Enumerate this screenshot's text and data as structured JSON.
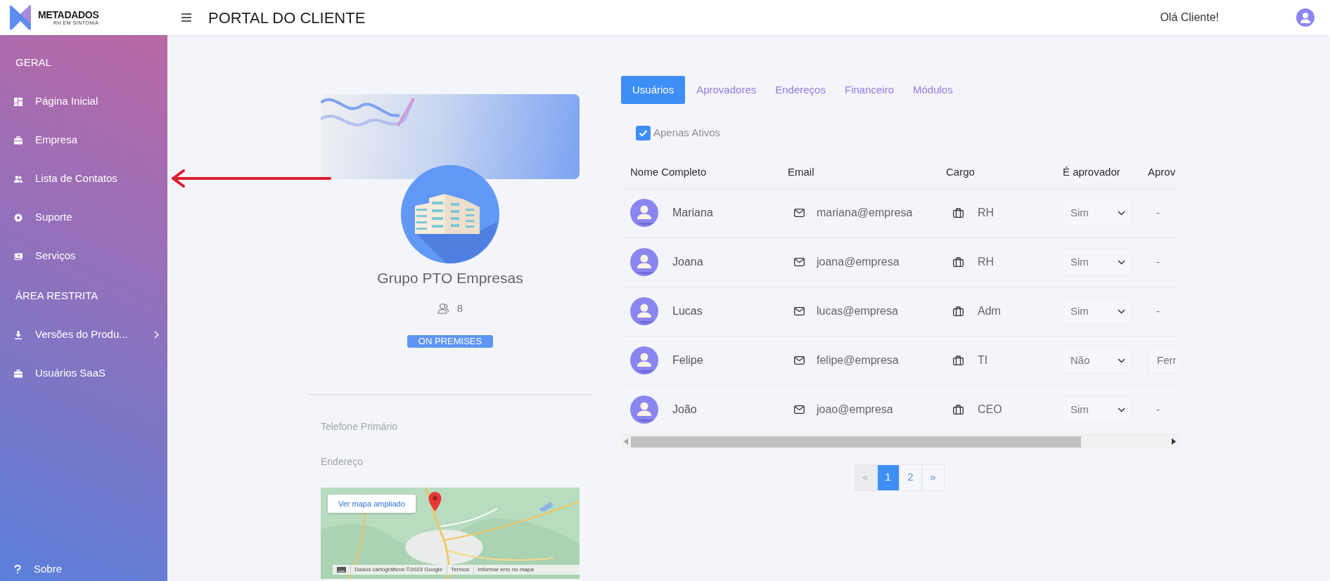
{
  "header": {
    "brand": "METADADOS",
    "tagline": "RH EM SINTONIA",
    "title": "PORTAL DO CLIENTE",
    "greeting": "Olá Cliente!"
  },
  "sidebar": {
    "sections": [
      {
        "heading": "GERAL",
        "items": [
          {
            "label": "Página Inicial",
            "has_submenu": false
          },
          {
            "label": "Empresa",
            "has_submenu": false
          },
          {
            "label": "Lista de Contatos",
            "has_submenu": false
          },
          {
            "label": "Suporte",
            "has_submenu": false
          },
          {
            "label": "Serviços",
            "has_submenu": false
          }
        ]
      },
      {
        "heading": "ÁREA RESTRITA",
        "items": [
          {
            "label": "Versões do Produ...",
            "has_submenu": true
          },
          {
            "label": "Usuários SaaS",
            "has_submenu": false
          }
        ]
      }
    ],
    "footer": "Sobre"
  },
  "company": {
    "name": "Grupo PTO Empresas",
    "users": "8",
    "badge": "ON PREMISES",
    "fields": [
      "Telefone Primário",
      "Endereço"
    ],
    "map": {
      "link": "Ver mapa ampliado",
      "attribution": [
        "Dados cartográficos ©2023 Google",
        "Termos",
        "Informar erro no mapa"
      ]
    }
  },
  "tabs": [
    {
      "label": "Usuários",
      "selected": true
    },
    {
      "label": "Aprovadores",
      "selected": false
    },
    {
      "label": "Endereços",
      "selected": false
    },
    {
      "label": "Financeiro",
      "selected": false
    },
    {
      "label": "Módulos",
      "selected": false
    }
  ],
  "filter": {
    "label": "Apenas Ativos",
    "checked": true
  },
  "table": {
    "columns": [
      "Nome Completo",
      "Email",
      "Cargo",
      "É aprovador",
      "Aprov"
    ],
    "rows": [
      {
        "name": "Mariana",
        "email": "mariana@empresa",
        "role": "RH",
        "approver": "Sim",
        "column_5": {
          "kind": "text",
          "text": "-"
        }
      },
      {
        "name": "Joana",
        "email": "joana@empresa",
        "role": "RH",
        "approver": "Sim",
        "column_5": {
          "kind": "text",
          "text": "-"
        }
      },
      {
        "name": "Lucas",
        "email": "lucas@empresa",
        "role": "Adm",
        "approver": "Sim",
        "column_5": {
          "kind": "text",
          "text": "-"
        }
      },
      {
        "name": "Felipe",
        "email": "felipe@empresa",
        "role": "TI",
        "approver": "Não",
        "column_5": {
          "kind": "select",
          "text": "Ferr"
        }
      },
      {
        "name": "João",
        "email": "joao@empresa",
        "role": "CEO",
        "approver": "Sim",
        "column_5": {
          "kind": "text",
          "text": "-"
        }
      }
    ]
  },
  "pagination": [
    {
      "label": "«",
      "selected": false,
      "disabled": true
    },
    {
      "label": "1",
      "selected": true,
      "disabled": false
    },
    {
      "label": "2",
      "selected": false,
      "disabled": false
    },
    {
      "label": "»",
      "selected": false,
      "disabled": false
    }
  ]
}
